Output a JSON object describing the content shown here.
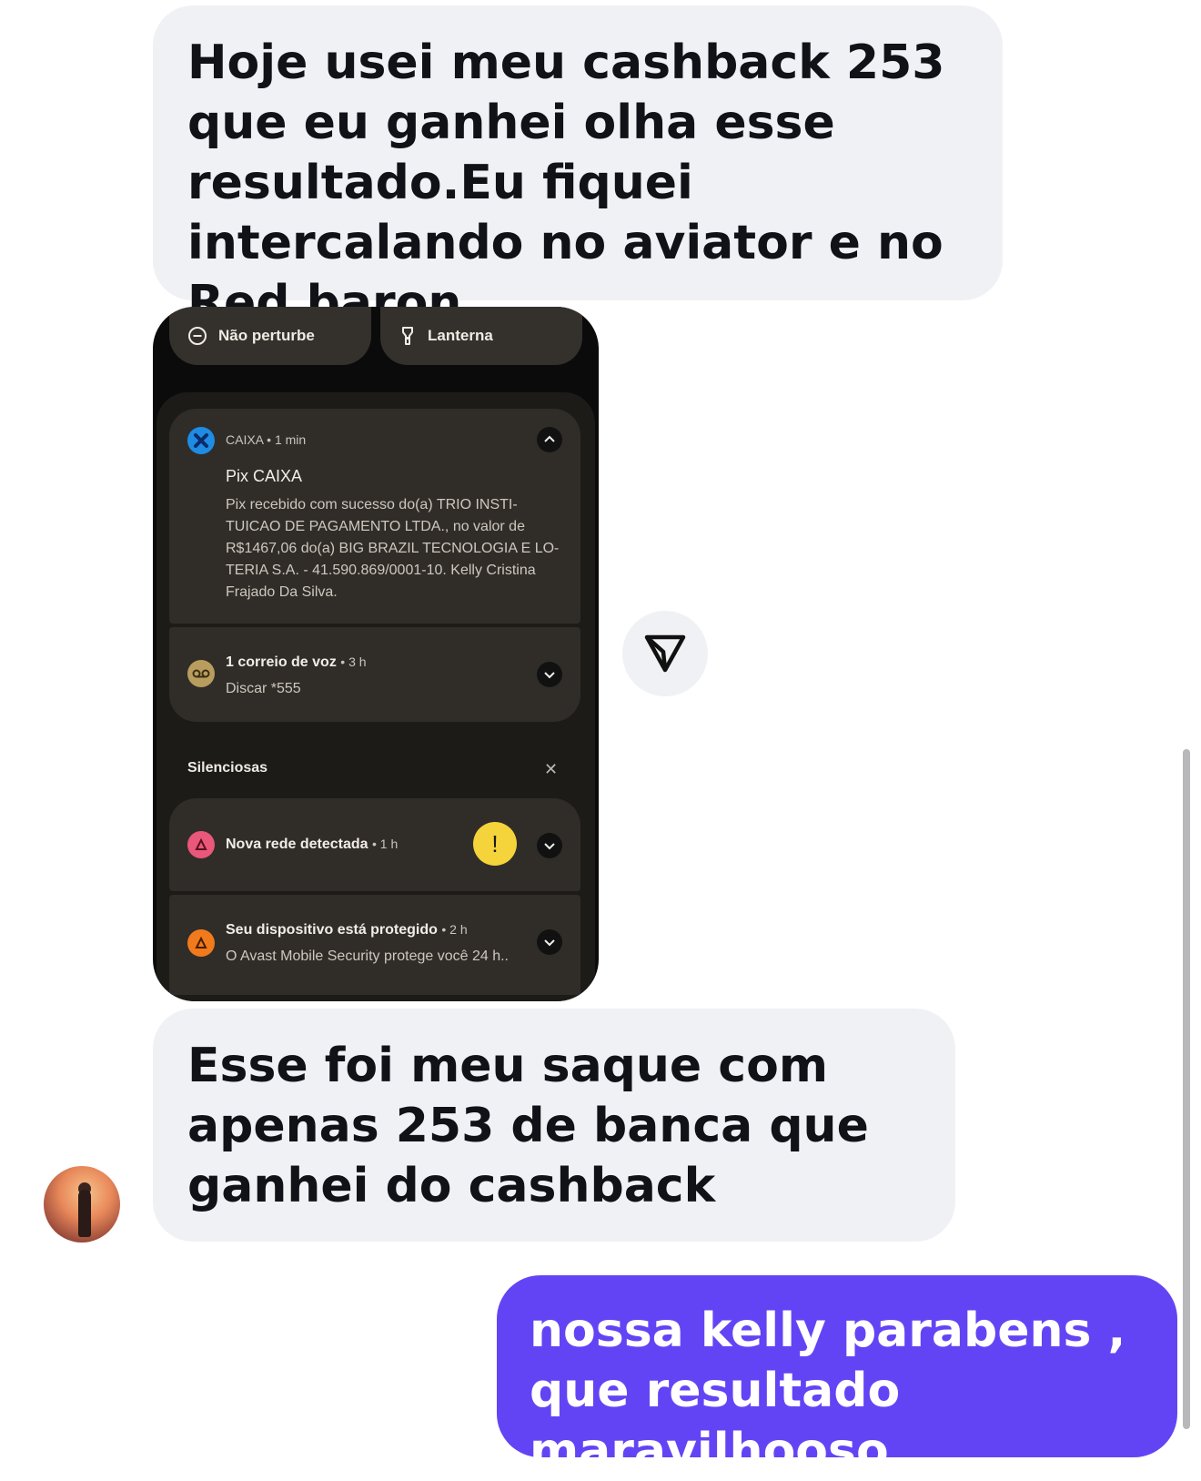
{
  "messages": {
    "first": "Hoje usei meu cashback 253 que eu ganhei olha esse resultado.Eu fiquei intercalando no aviator e no Red baron.",
    "second": "Esse foi meu saque com apenas 253 de banca que ganhei do cashback",
    "reply": "nossa kelly parabens , que resultado maravilhooso,"
  },
  "screenshot": {
    "quick_settings": {
      "dnd_label": "Não perturbe",
      "torch_label": "Lanterna"
    },
    "pix": {
      "app": "CAIXA",
      "time": "1 min",
      "title": "Pix CAIXA",
      "body_lines": [
        "Pix recebido com sucesso do(a) TRIO INSTI-",
        "TUICAO DE PAGAMENTO LTDA., no valor de",
        "R$1467,06 do(a) BIG BRAZIL TECNOLOGIA E LO-",
        "TERIA S.A. - 41.590.869/0001-10. Kelly Cristina",
        "Frajado Da Silva."
      ]
    },
    "voicemail": {
      "title": "1 correio de voz",
      "time": "3 h",
      "body": "Discar *555"
    },
    "silent_section": "Silenciosas",
    "network": {
      "title": "Nova rede detectada",
      "time": "1 h",
      "badge": "!"
    },
    "avast": {
      "title": "Seu dispositivo está protegido",
      "time": "2 h",
      "body": "O Avast Mobile Security protege você 24 h.."
    }
  },
  "icons": {
    "share": "send-triangle-icon",
    "dnd": "minus-circle-icon",
    "torch": "flashlight-icon"
  },
  "colors": {
    "incoming_bubble": "#f0f1f4",
    "outgoing_bubble": "#6344f5",
    "warning": "#f5d33a",
    "caixa": "#1e8ce3"
  }
}
